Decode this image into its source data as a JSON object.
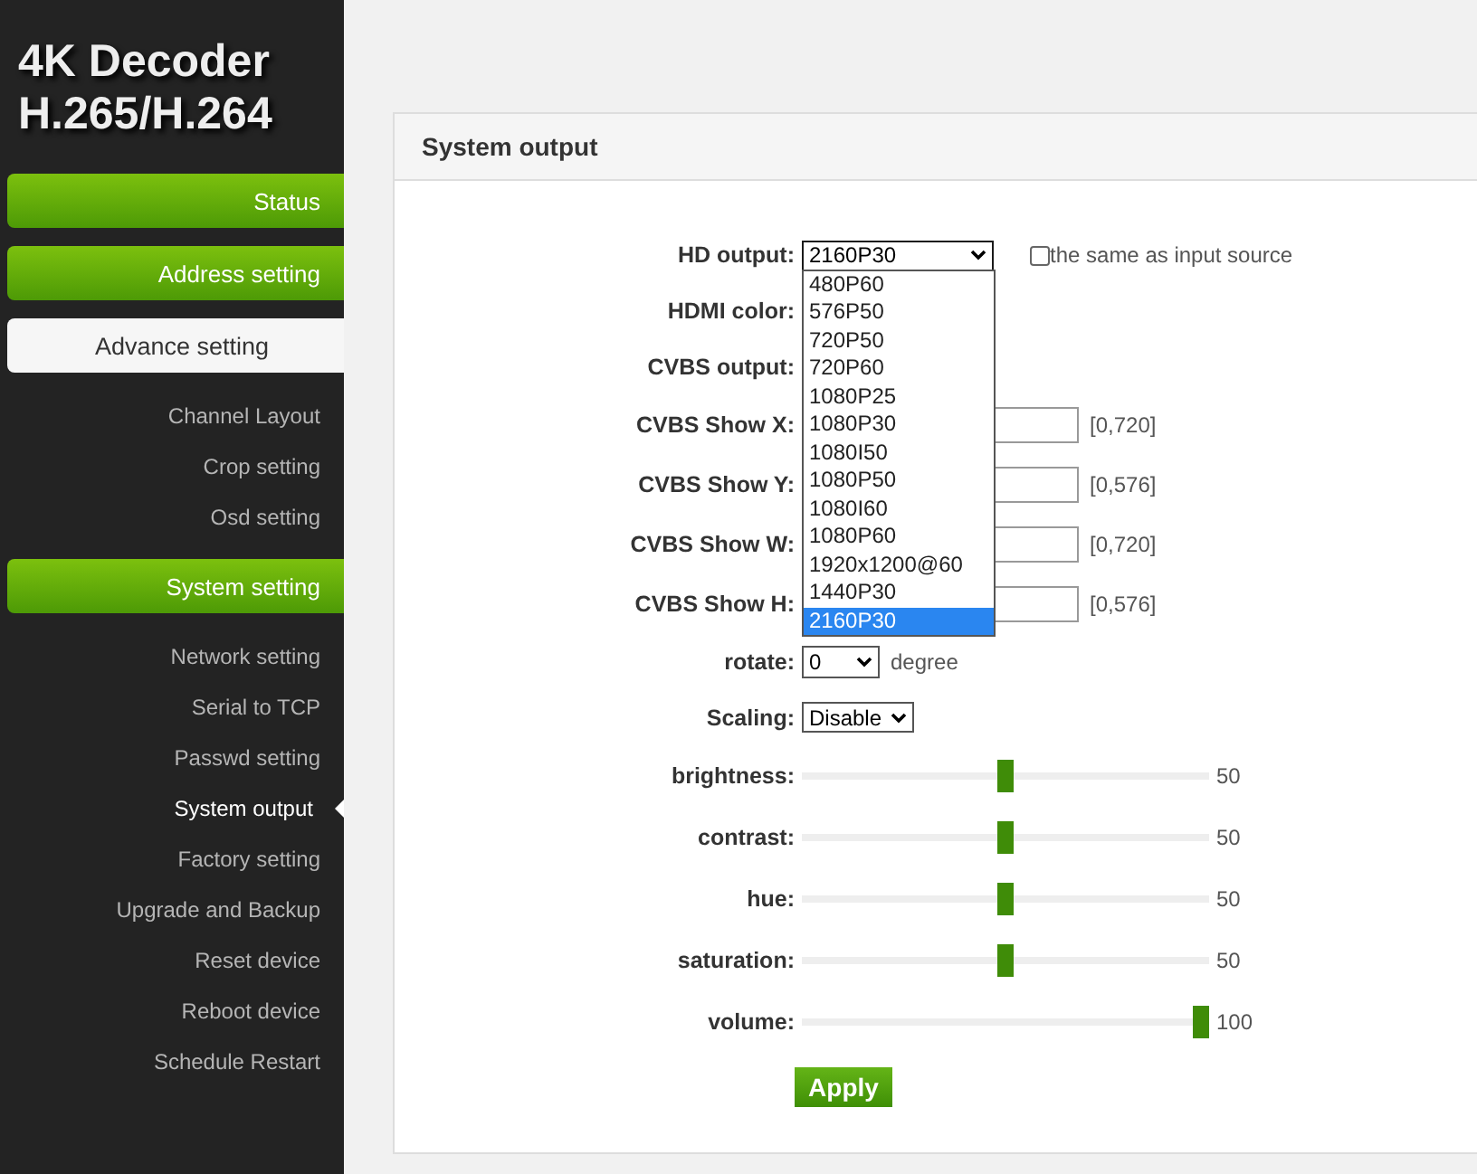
{
  "brand": {
    "line_1": "4K Decoder",
    "line_2": "H.265/H.264"
  },
  "nav": [
    {
      "kind": "header",
      "label": "Status",
      "highlighted": false
    },
    {
      "kind": "header",
      "label": "Address setting",
      "highlighted": false
    },
    {
      "kind": "header",
      "label": "Advance setting",
      "highlighted": true
    },
    {
      "kind": "sub",
      "label": "Channel Layout",
      "selected": false
    },
    {
      "kind": "sub",
      "label": "Crop setting",
      "selected": false
    },
    {
      "kind": "sub",
      "label": "Osd setting",
      "selected": false
    },
    {
      "kind": "header",
      "label": "System setting",
      "highlighted": false
    },
    {
      "kind": "sub",
      "label": "Network setting",
      "selected": false
    },
    {
      "kind": "sub",
      "label": "Serial to TCP",
      "selected": false
    },
    {
      "kind": "sub",
      "label": "Passwd setting",
      "selected": false
    },
    {
      "kind": "sub",
      "label": "System output",
      "selected": true
    },
    {
      "kind": "sub",
      "label": "Factory setting",
      "selected": false
    },
    {
      "kind": "sub",
      "label": "Upgrade and Backup",
      "selected": false
    },
    {
      "kind": "sub",
      "label": "Reset device",
      "selected": false
    },
    {
      "kind": "sub",
      "label": "Reboot device",
      "selected": false
    },
    {
      "kind": "sub",
      "label": "Schedule Restart",
      "selected": false
    }
  ],
  "panel": {
    "title": "System output"
  },
  "hd_output": {
    "label": "HD output:",
    "value": "2160P30",
    "expanded": true,
    "same_as_input": {
      "label": "the same as input source",
      "checked": false
    },
    "options": [
      {
        "label": "480P60",
        "selected": false
      },
      {
        "label": "576P50",
        "selected": false
      },
      {
        "label": "720P50",
        "selected": false
      },
      {
        "label": "720P60",
        "selected": false
      },
      {
        "label": "1080P25",
        "selected": false
      },
      {
        "label": "1080P30",
        "selected": false
      },
      {
        "label": "1080I50",
        "selected": false
      },
      {
        "label": "1080P50",
        "selected": false
      },
      {
        "label": "1080I60",
        "selected": false
      },
      {
        "label": "1080P60",
        "selected": false
      },
      {
        "label": "1920x1200@60",
        "selected": false
      },
      {
        "label": "1440P30",
        "selected": false
      },
      {
        "label": "2160P30",
        "selected": true
      }
    ]
  },
  "hidden_rows": [
    {
      "label": "HDMI color:"
    },
    {
      "label": "CVBS output:"
    }
  ],
  "cvbs_fields": [
    {
      "label": "CVBS Show X:",
      "range": "[0,720]"
    },
    {
      "label": "CVBS Show Y:",
      "range": "[0,576]"
    },
    {
      "label": "CVBS Show W:",
      "range": "[0,720]"
    },
    {
      "label": "CVBS Show H:",
      "range": "[0,576]"
    }
  ],
  "rotate": {
    "label": "rotate:",
    "value": "0",
    "unit": "degree"
  },
  "scaling": {
    "label": "Scaling:",
    "value": "Disable"
  },
  "sliders": [
    {
      "label": "brightness:",
      "level": 0.5,
      "reading": "50"
    },
    {
      "label": "contrast:",
      "level": 0.5,
      "reading": "50"
    },
    {
      "label": "hue:",
      "level": 0.5,
      "reading": "50"
    },
    {
      "label": "saturation:",
      "level": 0.5,
      "reading": "50"
    },
    {
      "label": "volume:",
      "level": 1,
      "reading": "100"
    }
  ],
  "apply_button": "Apply"
}
